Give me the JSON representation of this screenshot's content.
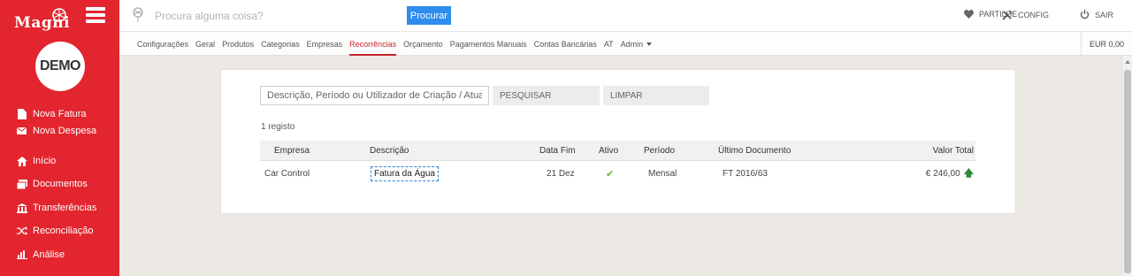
{
  "app": {
    "brand": "Magni",
    "account_logo": "DEMO"
  },
  "sidebar": {
    "items": [
      {
        "label": "Nova Fatura",
        "icon": "document-icon"
      },
      {
        "label": "Nova Despesa",
        "icon": "envelope-icon"
      },
      {
        "label": "Início",
        "icon": "home-icon"
      },
      {
        "label": "Documentos",
        "icon": "documents-icon"
      },
      {
        "label": "Transferências",
        "icon": "bank-icon"
      },
      {
        "label": "Reconciliação",
        "icon": "shuffle-icon"
      },
      {
        "label": "Análise",
        "icon": "bar-chart-icon"
      }
    ]
  },
  "topbar": {
    "search_placeholder": "Procura alguma coisa?",
    "search_button": "Procurar",
    "share_label": "PARTILHE",
    "config_label": "CONFIG",
    "logout_label": "SAIR"
  },
  "nav": {
    "items": [
      "Configurações",
      "Geral",
      "Produtos",
      "Categorias",
      "Empresas",
      "Recorrências",
      "Orçamento",
      "Pagamentos Manuais",
      "Contas Bancárias",
      "AT",
      "Admin"
    ],
    "active": "Recorrências",
    "balance": "EUR 0,00"
  },
  "filters": {
    "placeholder": "Descrição, Período ou Utilizador de Criação / Atualiz",
    "search_button": "PESQUISAR",
    "clear_button": "LIMPAR"
  },
  "results": {
    "count": "1 registo"
  },
  "table": {
    "headers": [
      "Empresa",
      "Descrição",
      "Data Fim",
      "Ativo",
      "Período",
      "Último Documento",
      "Valor Total"
    ],
    "rows": [
      {
        "empresa": "Car Control",
        "descricao": "Fatura da Água",
        "data_fim": "21 Dez",
        "ativo": true,
        "periodo": "Mensal",
        "ultimo_documento": "FT 2016/63",
        "valor_total": "€ 246,00"
      }
    ]
  },
  "colors": {
    "sidebar": "#e2252e",
    "accent_blue": "#2e8ded",
    "active_tab": "#c7252c",
    "check_green": "#6cb33f"
  }
}
